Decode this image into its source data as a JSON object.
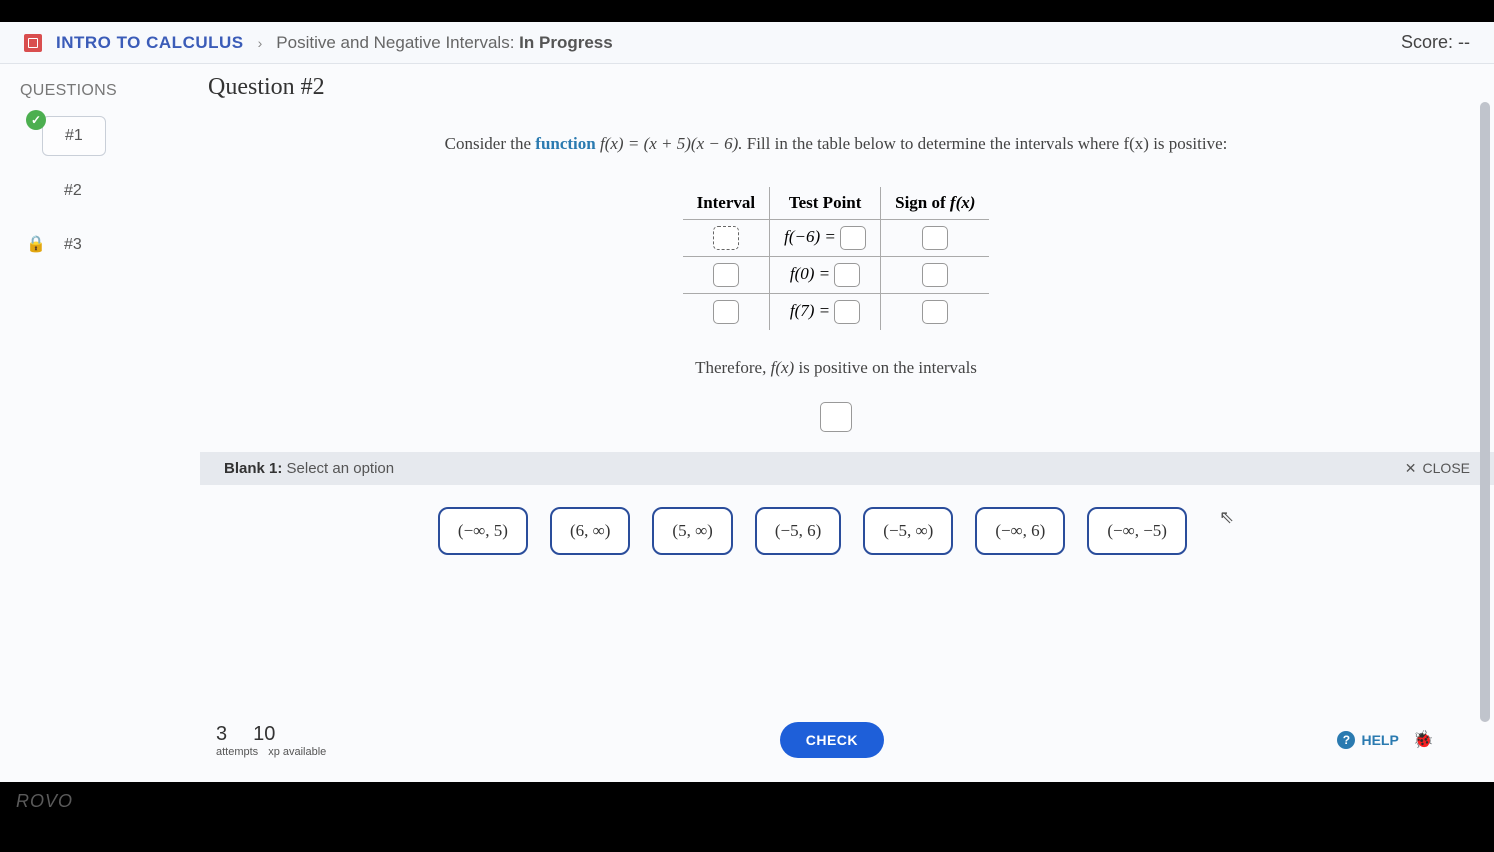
{
  "breadcrumb": {
    "course": "INTRO TO CALCULUS",
    "chevron": "›",
    "section": "Positive and Negative Intervals:",
    "status": "In Progress",
    "score_label": "Score: --"
  },
  "sidebar": {
    "title": "QUESTIONS",
    "items": [
      {
        "label": "#1",
        "state": "done"
      },
      {
        "label": "#2",
        "state": "current"
      },
      {
        "label": "#3",
        "state": "locked"
      }
    ]
  },
  "question": {
    "header": "Question #2",
    "prompt_pre": "Consider the ",
    "prompt_func_word": "function",
    "prompt_expr": " f(x) = (x + 5)(x − 6). ",
    "prompt_post": "Fill in the table below to determine the intervals where f(x) is positive:",
    "table": {
      "h1": "Interval",
      "h2": "Test Point",
      "h3": "Sign of f(x)",
      "rows": [
        {
          "tp": "f(−6) ="
        },
        {
          "tp": "f(0) ="
        },
        {
          "tp": "f(7) ="
        }
      ]
    },
    "conclusion": "Therefore, f(x) is positive on the intervals"
  },
  "options": {
    "blank_label_bold": "Blank 1:",
    "blank_label_rest": " Select an option",
    "close": "CLOSE",
    "items": [
      "(−∞, 5)",
      "(6, ∞)",
      "(5, ∞)",
      "(−5, 6)",
      "(−5, ∞)",
      "(−∞, 6)",
      "(−∞, −5)"
    ]
  },
  "footer": {
    "attempts_num": "3",
    "xp_num": "10",
    "attempts_lab": "attempts",
    "xp_lab": "xp available",
    "check": "CHECK",
    "help": "HELP"
  },
  "watermark": "ROVO"
}
